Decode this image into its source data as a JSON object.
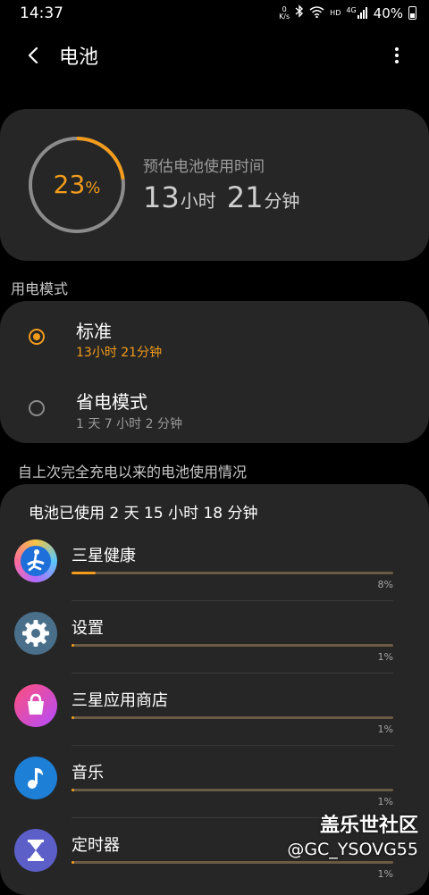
{
  "status_bar": {
    "time": "14:37",
    "net_speed_top": "0",
    "net_speed_unit": "K/s",
    "hd_label": "HD",
    "signal_label": "4G",
    "battery_text": "40%"
  },
  "app_bar": {
    "title": "电池"
  },
  "battery_summary": {
    "percent_value": "23",
    "percent_sign": "%",
    "percent_fraction": 0.23,
    "estimate_label": "预估电池使用时间",
    "hours": "13",
    "hours_unit": "小时",
    "minutes": "21",
    "minutes_unit": "分钟",
    "accent_color": "#f39c1b"
  },
  "power_mode": {
    "section_label": "用电模式",
    "modes": [
      {
        "name": "标准",
        "sub": "13小时 21分钟",
        "selected": true
      },
      {
        "name": "省电模式",
        "sub": "1 天 7 小时 2 分钟",
        "selected": false
      }
    ]
  },
  "usage": {
    "section_label": "自上次完全充电以来的电池使用情况",
    "total_used": "电池已使用 2 天 15 小时 18 分钟",
    "apps": [
      {
        "name": "三星健康",
        "percent_text": "8%",
        "fraction": 0.08,
        "icon": "samsung-health-icon"
      },
      {
        "name": "设置",
        "percent_text": "1%",
        "fraction": 0.01,
        "icon": "settings-gear-icon"
      },
      {
        "name": "三星应用商店",
        "percent_text": "1%",
        "fraction": 0.01,
        "icon": "galaxy-store-bag-icon"
      },
      {
        "name": "音乐",
        "percent_text": "1%",
        "fraction": 0.01,
        "icon": "music-note-icon"
      },
      {
        "name": "定时器",
        "percent_text": "1%",
        "fraction": 0.01,
        "icon": "hourglass-icon"
      }
    ]
  },
  "watermark": {
    "line1": "盖乐世社区",
    "line2": "@GC_YSOVG55"
  }
}
